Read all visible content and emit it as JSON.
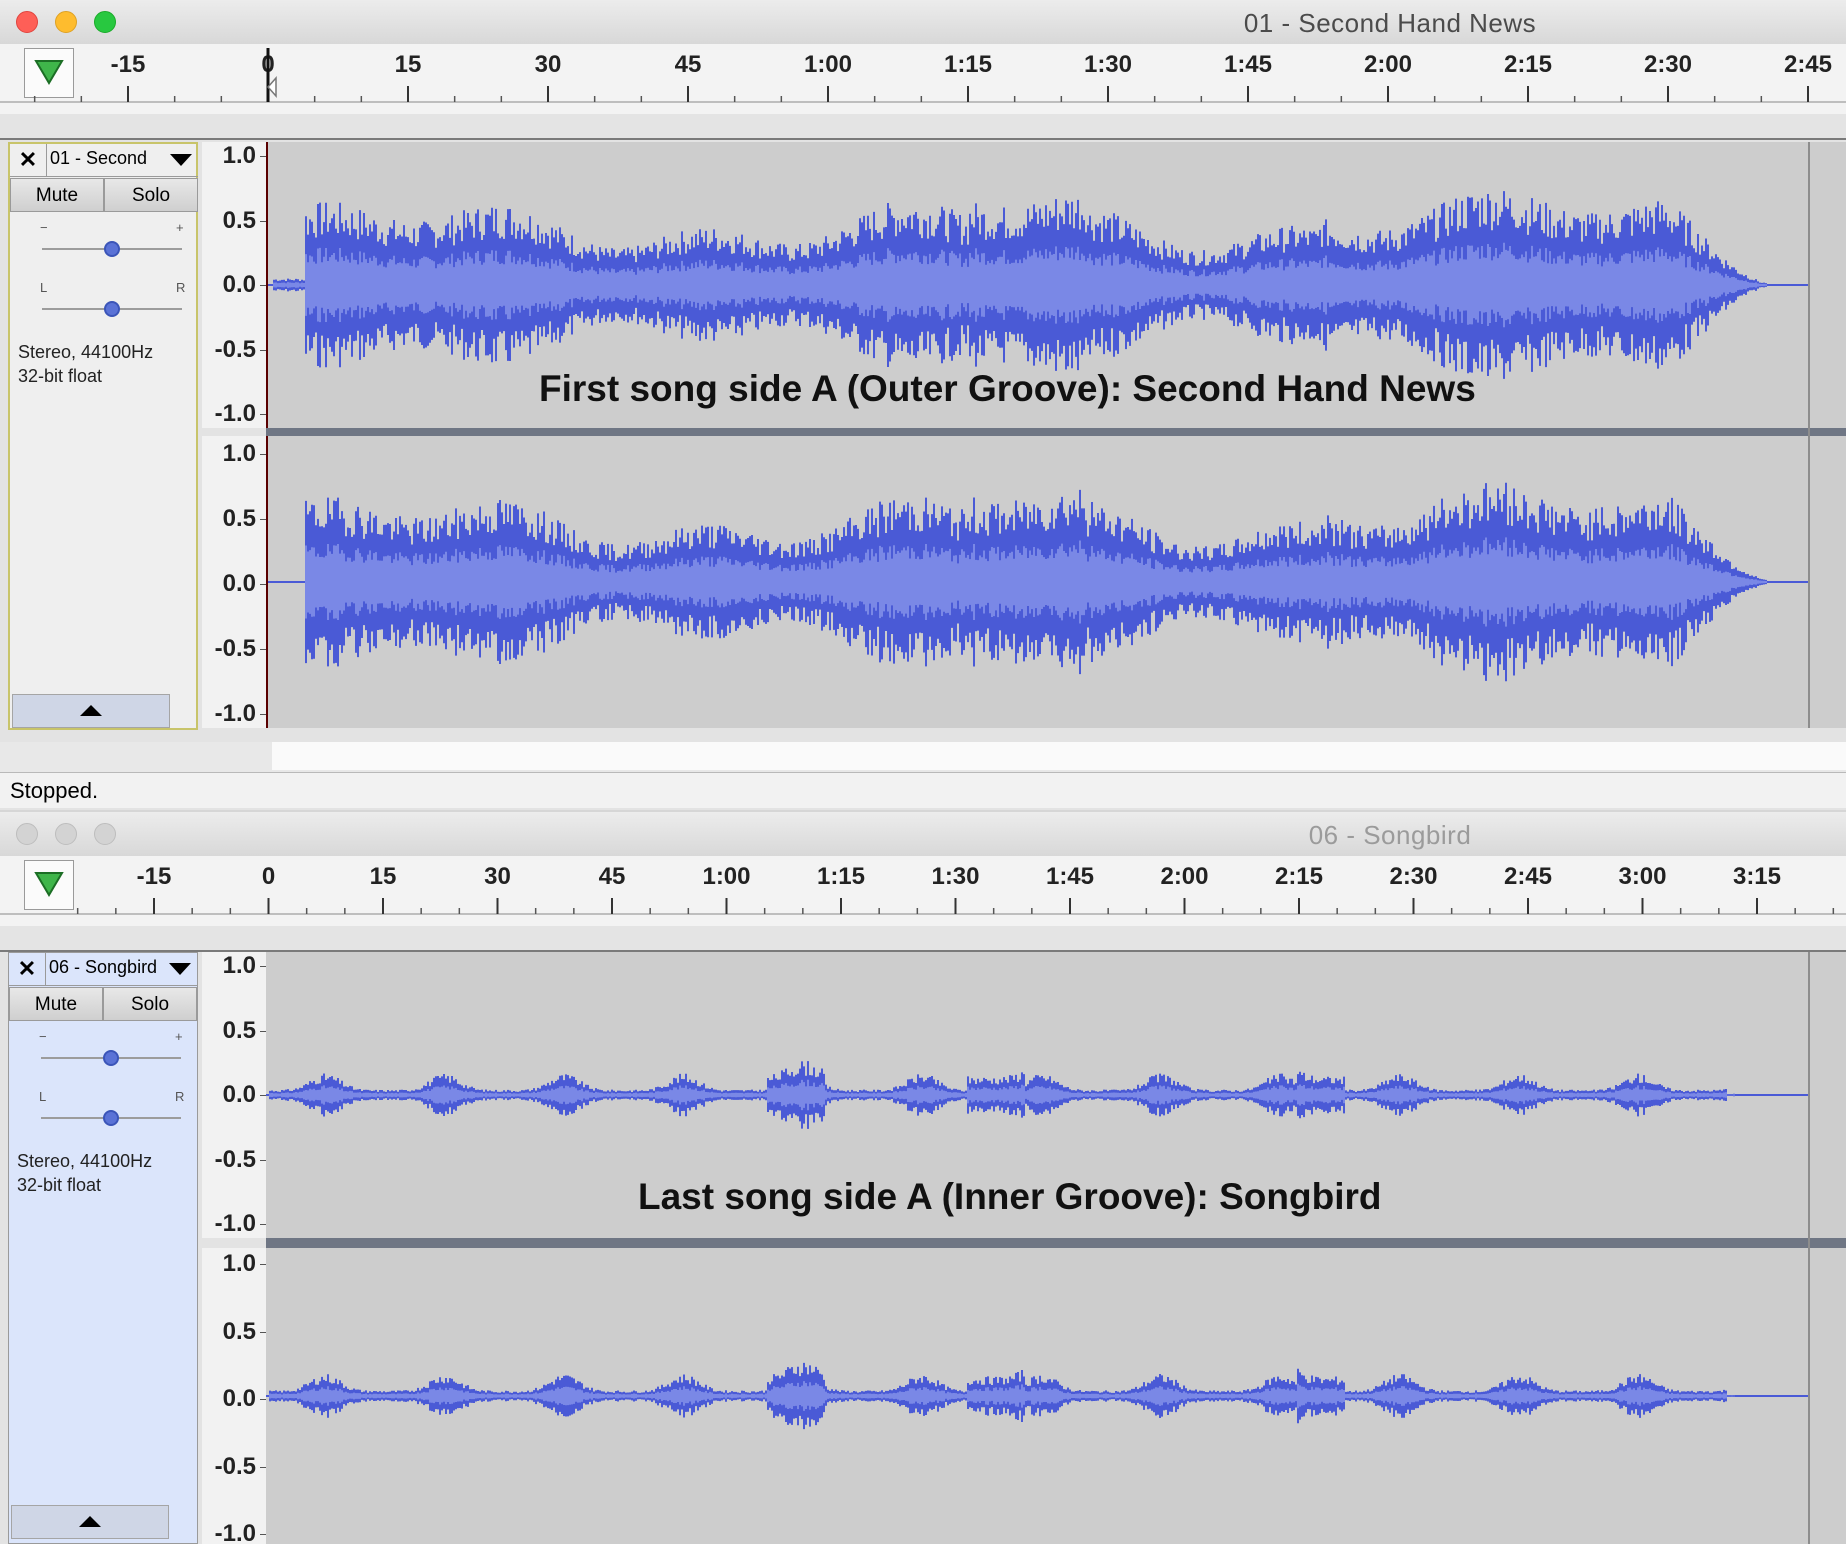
{
  "windows": [
    {
      "title": "01 - Second Hand News",
      "ruler_ticks": [
        "-15",
        "0",
        "15",
        "30",
        "45",
        "1:00",
        "1:15",
        "1:30",
        "1:45",
        "2:00",
        "2:15",
        "2:30",
        "2:45"
      ],
      "track": {
        "name": "01 - Second",
        "mute_label": "Mute",
        "solo_label": "Solo",
        "gain_minus": "−",
        "gain_plus": "+",
        "pan_left": "L",
        "pan_right": "R",
        "gain_level": 0.5,
        "pan_level": 0.5,
        "format_line1": "Stereo, 44100Hz",
        "format_line2": "32-bit float",
        "selected": false
      },
      "amplitude_labels": [
        "1.0",
        "0.5",
        "0.0",
        "-0.5",
        "-1.0"
      ],
      "caption": "First song side A (Outer Groove): Second Hand News",
      "status": "Stopped."
    },
    {
      "title": "06 - Songbird",
      "ruler_ticks": [
        "-15",
        "0",
        "15",
        "30",
        "45",
        "1:00",
        "1:15",
        "1:30",
        "1:45",
        "2:00",
        "2:15",
        "2:30",
        "2:45",
        "3:00",
        "3:15"
      ],
      "track": {
        "name": "06 - Songbird",
        "mute_label": "Mute",
        "solo_label": "Solo",
        "gain_minus": "−",
        "gain_plus": "+",
        "pan_left": "L",
        "pan_right": "R",
        "gain_level": 0.5,
        "pan_level": 0.5,
        "format_line1": "Stereo, 44100Hz",
        "format_line2": "32-bit float",
        "selected": true
      },
      "amplitude_labels": [
        "1.0",
        "0.5",
        "0.0",
        "-0.5",
        "-1.0"
      ],
      "caption": "Last song side A (Inner Groove): Songbird"
    }
  ],
  "colors": {
    "waveform": "#4a5ad6",
    "waveform_rms": "#7a88e6",
    "track_bg": "#cdcdcd",
    "selected_panel": "#dbe5fb"
  },
  "icons": {
    "close": "✕",
    "playhead": "triangle-down-green",
    "collapse": "triangle-up",
    "dropdown": "triangle-down"
  }
}
